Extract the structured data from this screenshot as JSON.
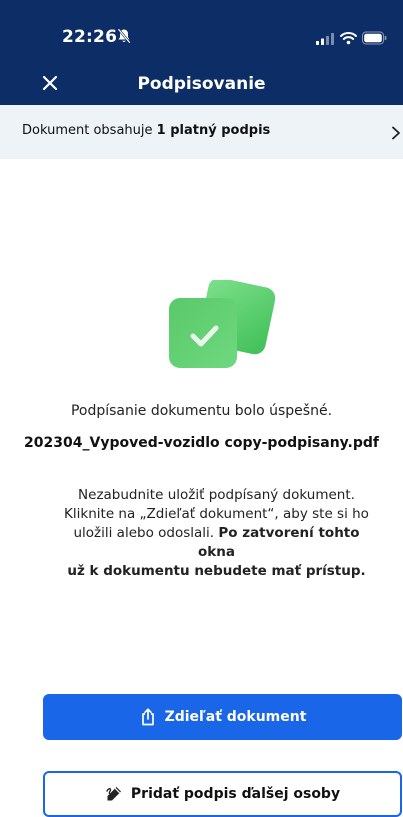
{
  "status_bar": {
    "time": "22:26",
    "icons": [
      "bell-slash-icon",
      "signal-icon",
      "wifi-icon",
      "battery-icon"
    ]
  },
  "nav": {
    "title": "Podpisovanie",
    "close_icon": "close-icon"
  },
  "signature_banner": {
    "prefix": "Dokument obsahuje ",
    "count_text": "1 platný podpis",
    "icon": "chevron-right-icon"
  },
  "result": {
    "success_text": "Podpísanie dokumentu bolo úspešné.",
    "filename": "202304_Vypoved-vozidlo copy-podpisany.pdf",
    "note_line1": "Nezabudnite uložiť podpísaný dokument.",
    "note_line2": "Kliknite na „Zdieľať dokument“, aby ste si ho",
    "note_line3": "uložili alebo odoslali. ",
    "note_bold1": "Po zatvorení tohto okna",
    "note_bold2": "už k dokumentu nebudete mať prístup."
  },
  "actions": {
    "share_label": "Zdieľať dokument",
    "add_signature_label": "Pridať podpis ďalšej osoby"
  },
  "colors": {
    "header_bg": "#0d2d66",
    "banner_bg": "#eef3f8",
    "primary": "#1a66e8",
    "success_green": "#5ccb6e"
  }
}
